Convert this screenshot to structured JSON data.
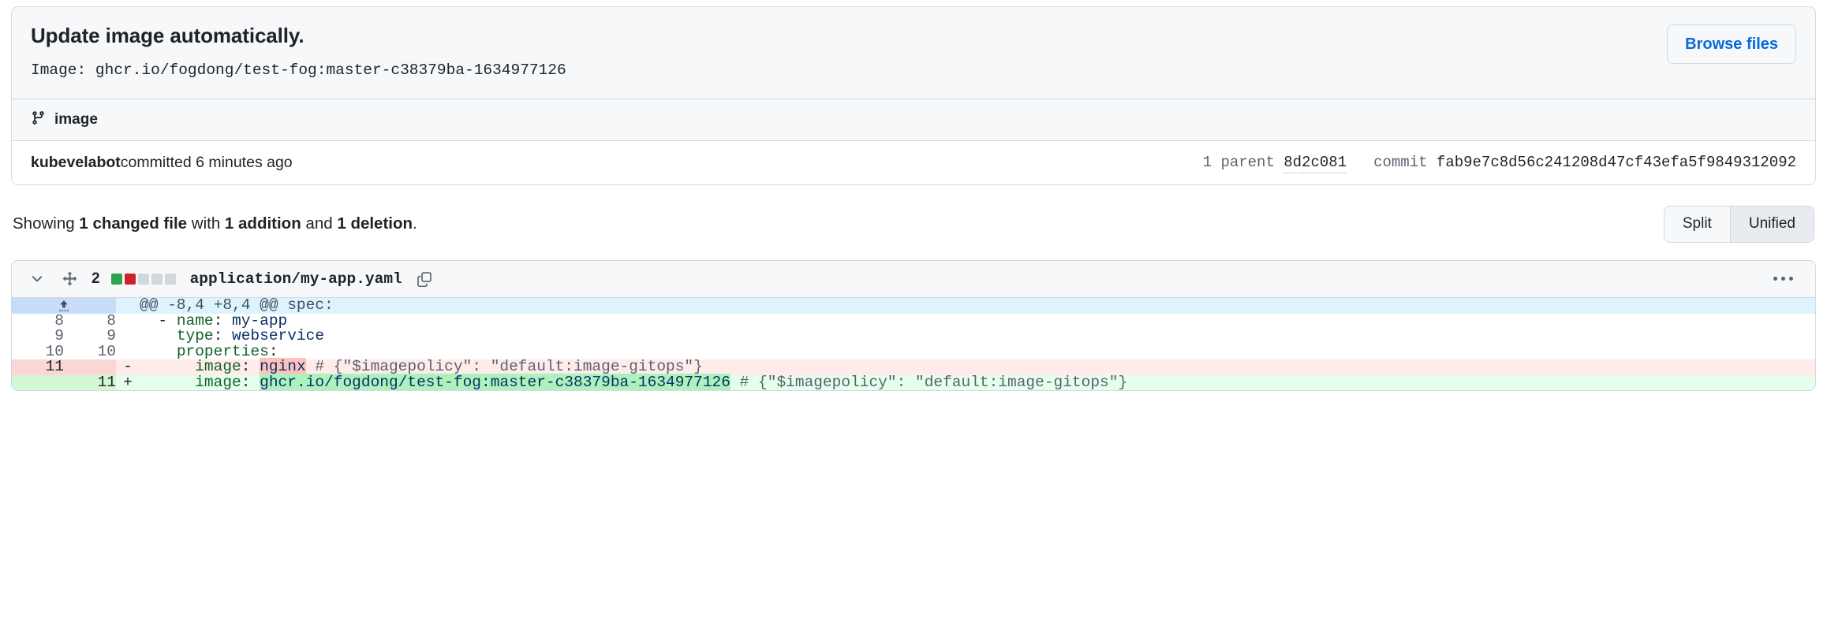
{
  "commit": {
    "title": "Update image automatically.",
    "description": "Image: ghcr.io/fogdong/test-fog:master-c38379ba-1634977126",
    "browse_files_label": "Browse files",
    "branch_name": "image",
    "branch_icon": "git-branch-icon",
    "author": "kubevelabot",
    "author_action": " committed 6 minutes ago",
    "parent_label": "1 parent",
    "parent_sha": "8d2c081",
    "commit_label": "commit",
    "commit_sha": "fab9e7c8d56c241208d47cf43efa5f9849312092"
  },
  "summary": {
    "prefix": "Showing ",
    "changed_files": "1 changed file",
    "mid": " with ",
    "additions": "1 addition",
    "conj": " and ",
    "deletions": "1 deletion",
    "suffix": "."
  },
  "view_toggle": {
    "split_label": "Split",
    "unified_label": "Unified",
    "selected": "Unified"
  },
  "file": {
    "collapse_icon": "chevron-down-icon",
    "move_icon": "arrows-move-icon",
    "change_count": "2",
    "diffstat_squares": [
      "#2da44e",
      "#cf222e",
      "#d0d7de",
      "#d0d7de",
      "#d0d7de"
    ],
    "path": "application/my-app.yaml",
    "copy_icon": "copy-icon",
    "menu_icon": "kebab-horizontal-icon"
  },
  "hunk": {
    "expand_icon": "expand-up-icon",
    "header": "@@ -8,4 +8,4 @@ spec:"
  },
  "diff_rows": [
    {
      "type": "ctx",
      "old_num": "8",
      "new_num": "8",
      "mark": "",
      "segments": [
        {
          "text": "  - ",
          "style": "plain"
        },
        {
          "text": "name",
          "style": "key"
        },
        {
          "text": ": ",
          "style": "plain"
        },
        {
          "text": "my-app",
          "style": "val"
        }
      ]
    },
    {
      "type": "ctx",
      "old_num": "9",
      "new_num": "9",
      "mark": "",
      "segments": [
        {
          "text": "    ",
          "style": "plain"
        },
        {
          "text": "type",
          "style": "key"
        },
        {
          "text": ": ",
          "style": "plain"
        },
        {
          "text": "webservice",
          "style": "val"
        }
      ]
    },
    {
      "type": "ctx",
      "old_num": "10",
      "new_num": "10",
      "mark": "",
      "segments": [
        {
          "text": "    ",
          "style": "plain"
        },
        {
          "text": "properties",
          "style": "key"
        },
        {
          "text": ":",
          "style": "plain"
        }
      ]
    },
    {
      "type": "del",
      "old_num": "11",
      "new_num": "",
      "mark": "-",
      "segments": [
        {
          "text": "      ",
          "style": "plain"
        },
        {
          "text": "image",
          "style": "key"
        },
        {
          "text": ": ",
          "style": "plain"
        },
        {
          "text": "nginx",
          "style": "val",
          "word_highlight": "del"
        },
        {
          "text": " ",
          "style": "plain"
        },
        {
          "text": "# {\"$imagepolicy\": \"default:image-gitops\"}",
          "style": "com"
        }
      ]
    },
    {
      "type": "add",
      "old_num": "",
      "new_num": "11",
      "mark": "+",
      "segments": [
        {
          "text": "      ",
          "style": "plain"
        },
        {
          "text": "image",
          "style": "key"
        },
        {
          "text": ": ",
          "style": "plain"
        },
        {
          "text": "ghcr.io/fogdong/test-fog:master-c38379ba-1634977126",
          "style": "val",
          "word_highlight": "add"
        },
        {
          "text": " ",
          "style": "plain"
        },
        {
          "text": "# {\"$imagepolicy\": \"default:image-gitops\"}",
          "style": "com"
        }
      ]
    }
  ]
}
